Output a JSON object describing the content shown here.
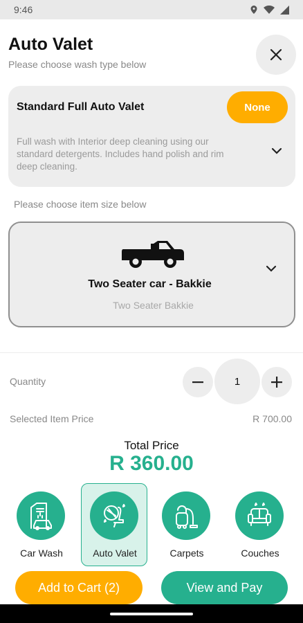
{
  "status_bar": {
    "time": "9:46"
  },
  "header": {
    "title": "Auto Valet",
    "subtitle": "Please choose wash type below"
  },
  "wash_type": {
    "title": "Standard Full Auto Valet",
    "selector_label": "None",
    "description": "Full wash with Interior deep cleaning using our standard detergents. Includes  hand polish and rim deep cleaning."
  },
  "size": {
    "prompt": "Please choose item size below",
    "title": "Two Seater car - Bakkie",
    "subtitle": "Two Seater Bakkie"
  },
  "quantity": {
    "label": "Quantity",
    "value": "1"
  },
  "selected_price": {
    "label": "Selected Item Price",
    "value": "R 700.00"
  },
  "total": {
    "label": "Total Price",
    "value": "R 360.00"
  },
  "services": [
    {
      "label": "Car Wash",
      "active": false
    },
    {
      "label": "Auto Valet",
      "active": true
    },
    {
      "label": "Carpets",
      "active": false
    },
    {
      "label": "Couches",
      "active": false
    }
  ],
  "buttons": {
    "add_to_cart": "Add to Cart (2)",
    "view_and_pay": "View and Pay"
  },
  "colors": {
    "accent_green": "#26b08e",
    "accent_orange": "#ffad00",
    "card_bg": "#ededed"
  }
}
